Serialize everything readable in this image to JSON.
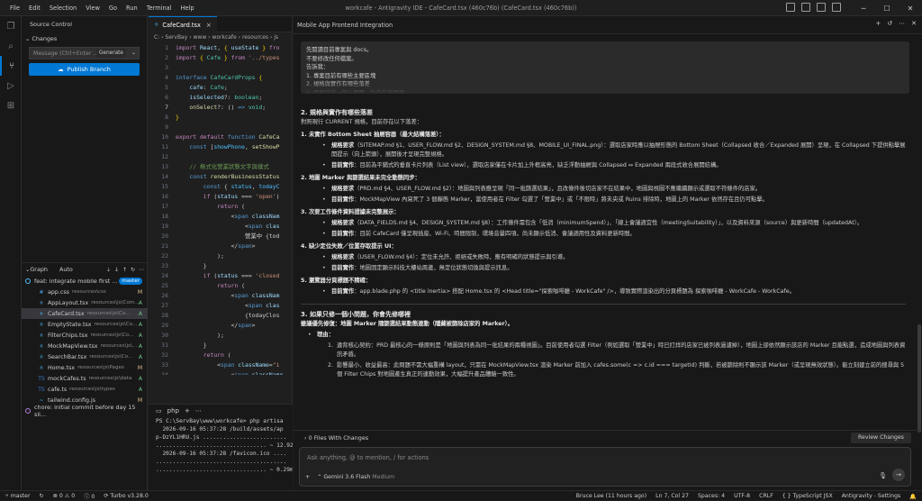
{
  "menu": [
    "File",
    "Edit",
    "Selection",
    "View",
    "Go",
    "Run",
    "Terminal",
    "Help"
  ],
  "window_title": "workcafe - Antigravity IDE - CafeCard.tsx (460c76b) (CafeCard.tsx (460c76b))",
  "sidebar": {
    "title": "Source Control",
    "changes_label": "Changes",
    "message_placeholder": "Message (Ctrl+Enter ...",
    "generate_label": "Generate",
    "publish_label": "Publish Branch",
    "graph_label": "Graph",
    "auto_label": "Auto",
    "commit": {
      "text": "feat: integrate mobile first ...",
      "branch": "master"
    },
    "files": [
      {
        "icon": "#",
        "color": "#42a5f5",
        "name": "app.css",
        "path": "resources\\css",
        "status": "M"
      },
      {
        "icon": "⚛",
        "color": "#4fc1ff",
        "name": "AppLayout.tsx",
        "path": "resources\\js\\Com...",
        "status": "A"
      },
      {
        "icon": "⚛",
        "color": "#4fc1ff",
        "name": "CafeCard.tsx",
        "path": "resources\\js\\Co...",
        "status": "A"
      },
      {
        "icon": "⚛",
        "color": "#4fc1ff",
        "name": "EmptyState.tsx",
        "path": "resources\\js\\Co...",
        "status": "A"
      },
      {
        "icon": "⚛",
        "color": "#4fc1ff",
        "name": "FilterChips.tsx",
        "path": "resources\\js\\Co...",
        "status": "A"
      },
      {
        "icon": "⚛",
        "color": "#4fc1ff",
        "name": "MockMapView.tsx",
        "path": "resources\\js\\...",
        "status": "A"
      },
      {
        "icon": "⚛",
        "color": "#4fc1ff",
        "name": "SearchBar.tsx",
        "path": "resources\\js\\Co...",
        "status": "A"
      },
      {
        "icon": "⚛",
        "color": "#4fc1ff",
        "name": "Home.tsx",
        "path": "resources\\js\\Pages",
        "status": "M"
      },
      {
        "icon": "TS",
        "color": "#3178c6",
        "name": "mockCafes.ts",
        "path": "resources\\js\\data",
        "status": "A"
      },
      {
        "icon": "TS",
        "color": "#3178c6",
        "name": "cafe.ts",
        "path": "resources\\js\\types",
        "status": "A"
      },
      {
        "icon": "~",
        "color": "#38bdf8",
        "name": "tailwind.config.js",
        "path": "",
        "status": "M"
      }
    ],
    "old_commit": "chore: initial commit before day 15 sli..."
  },
  "editor": {
    "tab": "CafeCard.tsx",
    "breadcrumb": "C: › ServBay › www › workcafe › resources › js",
    "current_line": 7,
    "terminal_tab": "php",
    "terminal_lines": [
      "PS C:\\ServBay\\www\\workcafe> php artisa",
      "  2026-09-16 05:37:28 /build/assets/ap",
      "p-DzYL1HRU.js .........................",
      "................................. ~ 12.92ms",
      "  2026-09-16 05:37:28 /favicon.ico ....",
      ".......................................",
      "................................. ~ 0.29ms"
    ]
  },
  "chat": {
    "title": "Mobile App Frontend Integration",
    "user_lines": [
      "先閱讀目前專案與 docs。",
      "不要修改任何檔案。",
      "告訴我：",
      "1. 專案目前有哪些主要區塊",
      "2. 規格與實作有哪些落差",
      "3. 如果只修一個小問題，你會先修哪裡"
    ],
    "sec2_title": "2. 規格與實作有哪些落差",
    "sec2_intro": "對照現行 CURRENT 規格，目前存在以下落差：",
    "label_spec": "規格要求",
    "label_impl": "目前實作",
    "gaps": [
      {
        "title": "1. 未實作 Bottom Sheet 抽屜容器（最大結構落差）：",
        "spec": "（SITEMAP.md §1、USER_FLOW.md §2、DESIGN_SYSTEM.md §8、MOBILE_UI_FINAL.png）：選取店家時應以抽屜形態的 Bottom Sheet（Collapsed 收合／Expanded 展開）呈現，在 Collapsed 下提供點擊展開提示（向上箭頭），展開後才呈現完整規格。",
        "impl": "目前為平鋪式的垂直卡片列表（List view），選取店家僅在卡片加上外框高亮，缺乏浮動抽屜與 Collapsed ↔ Expanded 兩段式收合展開結構。"
      },
      {
        "title": "2. 地圖 Marker 與篩選結果未完全動態同步：",
        "spec": "（PRD.md §4、USER_FLOW.md §2）：地圖與列表應呈現「同一批篩選結果」，且改條件後切店家不在結果中，地圖與視圖不應繼續顯示或選取不符條件的店家。",
        "impl": "MockMapView 內寫死了 3 個靜態 Marker，當使用者在 Filter 勾選了「營業中」或「不限時」將未央或 Ruins 排除時，地圖上的 Marker 依然存在且仍可點擊。"
      },
      {
        "title": "3. 次要工作條件資料證據未完整展示：",
        "spec": "（DATA_FIELDS.md §4、DESIGN_SYSTEM.md §8）：工作條件需包含「低消（minimumSpend）」、「線上會議適宜性（meetingSuitability）」，以及資料來源（source）與更新時間（updatedAt）。",
        "impl": "目前 CafeCard 僅呈現插座、Wi-Fi、時間限制，環境音量四項，尚未顯示低消、會議適用性及資料更新時間。"
      },
      {
        "title": "4. 缺少定位失敗／位置存取提示 UI：",
        "spec": "（USER_FLOW.md §4）：定位未允許、拒絕或失敗時，應有明確的狀態提示與引導。",
        "impl": "地圖固定顯示科技大樓站周邊，無定位狀態切換與提示訊息。"
      }
    ],
    "gap5_title": "5. 瀏覽器分頁標題不精確：",
    "gap5_impl": "app.blade.php 的 <title inertia> 搭配 Home.tsx 的 <Head title=\"探索咖啡廳 - WorkCafe\" />，導致實際渲染出的分頁標題為 探索咖啡廳 - WorkCafe - WorkCafe。",
    "sec3_title": "3. 如果只修一個小問題，你會先修哪裡",
    "sec3_intro": "雖議優先修復：地圖 Marker 隨篩選結果動態連動（隱藏被篩除店家的 Marker）。",
    "reason_label": "理由：",
    "reasons": [
      {
        "title": "違背核心契約：",
        "text": "PRD 最核心的一條原則是「地圖與列表為同一批結果的兩種視圖」。目前使用者勾選 Filter（例如選取「營業中」時已打烊的店家已被列表過濾掉），地圖上卻依然顯示該店的 Marker 且能點選，造成地圖與列表資訊矛盾。"
      },
      {
        "title": "影響最小、收益最高：",
        "text": "此問題不需大幅重構 layout，只需在 MockMapView.tsx 渲染 Marker 前加入 cafes.some(c => c.id === targetId) 判斷，若被篩除則不顯示該 Marker（或呈現無效狀態）。能立刻建立前的搜尋與 5 個 Filter Chips 對地圖產生真正的連動效果，大幅提升產品體驗一致性。"
      }
    ],
    "files_changed": "0 Files With Changes",
    "review_label": "Review Changes",
    "input_placeholder": "Ask anything, @ to mention, / for actions",
    "model": "Gemini 3.6 Flash",
    "model_level": "Medium"
  },
  "status": {
    "branch": "master",
    "errors": "0",
    "warnings": "0",
    "info": "0",
    "turbo": "Turbo v3.28.0",
    "blame": "Bruce Lee (11 hours ago)",
    "cursor": "Ln 7, Col 27",
    "spaces": "Spaces: 4",
    "encoding": "UTF-8",
    "eol": "CRLF",
    "language": "TypeScript JSX",
    "account": "Antigravity - Settings"
  },
  "colors": {
    "accent": "#0078d4",
    "modified": "#e2c08d",
    "added": "#73c991"
  }
}
